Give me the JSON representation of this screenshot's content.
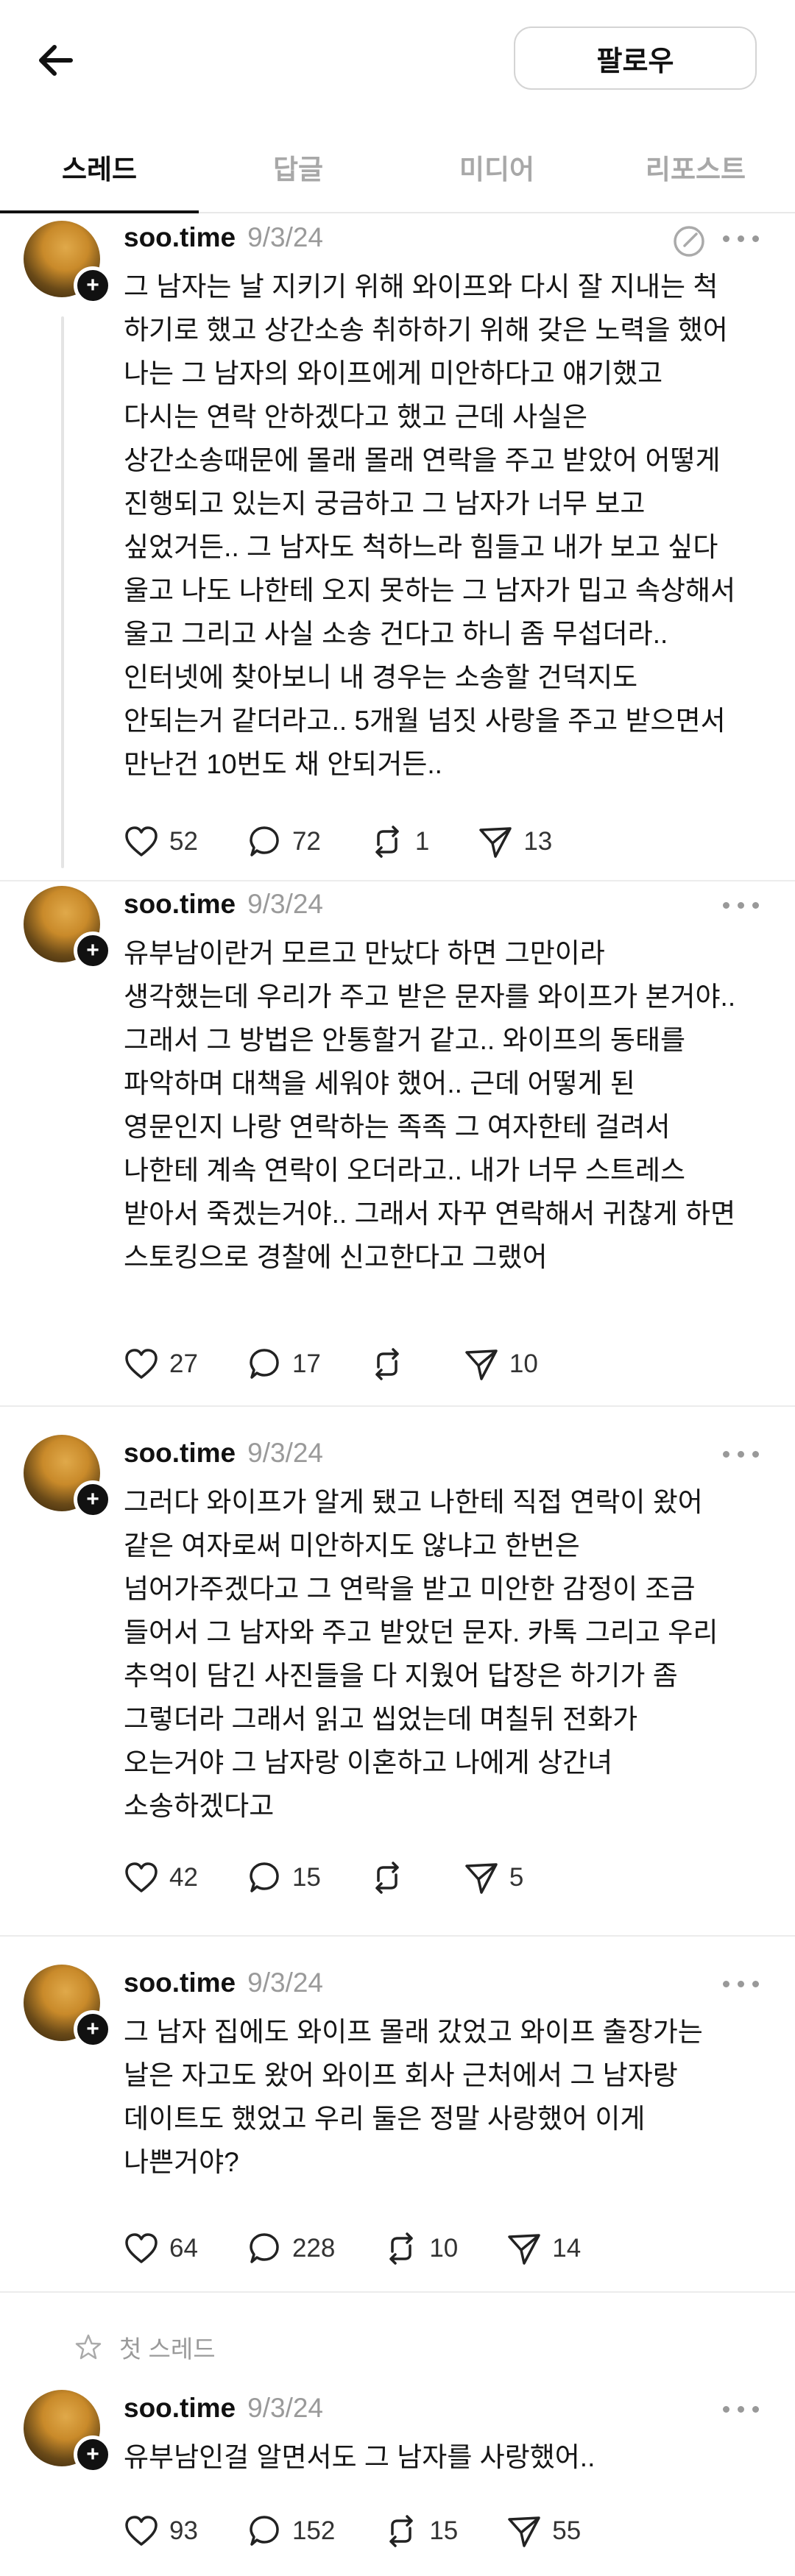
{
  "header": {
    "back_icon": "arrow-left-icon",
    "follow_label": "팔로우"
  },
  "tabs": [
    {
      "label": "스레드",
      "active": true
    },
    {
      "label": "답글",
      "active": false
    },
    {
      "label": "미디어",
      "active": false
    },
    {
      "label": "리포스트",
      "active": false
    }
  ],
  "posts": [
    {
      "username": "soo.time",
      "date": "9/3/24",
      "text": "그 남자는 날 지키기 위해 와이프와 다시 잘 지내는 척\n하기로 했고 상간소송 취하하기 위해 갖은 노력을 했어\n나는 그 남자의 와이프에게 미안하다고 얘기했고\n다시는 연락 안하겠다고 했고 근데 사실은\n상간소송때문에 몰래 몰래 연락을 주고 받았어 어떻게\n진행되고 있는지 궁금하고 그 남자가 너무 보고\n싶었거든.. 그 남자도 척하느라 힘들고 내가 보고 싶다\n울고 나도 나한테 오지 못하는 그 남자가 밉고 속상해서\n울고 그리고 사실 소송 건다고 하니 좀 무섭더라..\n인터넷에 찾아보니 내 경우는 소송할 건덕지도\n안되는거 같더라고.. 5개월 넘짓 사랑을 주고 받으면서\n만난건 10번도 채 안되거든..",
      "likes": "52",
      "replies": "72",
      "reposts": "1",
      "shares": "13"
    },
    {
      "username": "soo.time",
      "date": "9/3/24",
      "text": "유부남이란거 모르고 만났다 하면 그만이라\n생각했는데 우리가 주고 받은 문자를 와이프가 본거야..\n그래서 그 방법은 안통할거 같고.. 와이프의 동태를\n파악하며 대책을 세워야 했어.. 근데 어떻게 된\n영문인지 나랑 연락하는 족족 그 여자한테 걸려서\n나한테 계속 연락이 오더라고.. 내가 너무 스트레스\n받아서 죽겠는거야.. 그래서 자꾸 연락해서 귀찮게 하면\n스토킹으로 경찰에 신고한다고 그랬어",
      "likes": "27",
      "replies": "17",
      "reposts": "",
      "shares": "10"
    },
    {
      "username": "soo.time",
      "date": "9/3/24",
      "text": "그러다 와이프가 알게 됐고 나한테 직접 연락이 왔어\n같은 여자로써 미안하지도 않냐고 한번은\n넘어가주겠다고 그 연락을 받고 미안한 감정이 조금\n들어서 그 남자와 주고 받았던 문자. 카톡 그리고 우리\n추억이 담긴 사진들을 다 지웠어 답장은 하기가 좀\n그렇더라 그래서 읽고 씹었는데 며칠뒤 전화가\n오는거야 그 남자랑 이혼하고 나에게 상간녀\n소송하겠다고",
      "likes": "42",
      "replies": "15",
      "reposts": "",
      "shares": "5"
    },
    {
      "username": "soo.time",
      "date": "9/3/24",
      "text": "그 남자 집에도 와이프 몰래 갔었고 와이프 출장가는\n날은 자고도 왔어 와이프 회사 근처에서 그 남자랑\n데이트도 했었고 우리 둘은 정말 사랑했어 이게\n나쁜거야?",
      "likes": "64",
      "replies": "228",
      "reposts": "10",
      "shares": "14"
    },
    {
      "first_thread_label": "첫 스레드",
      "username": "soo.time",
      "date": "9/3/24",
      "text": "유부남인걸 알면서도 그 남자를 사랑했어..",
      "likes": "93",
      "replies": "152",
      "reposts": "15",
      "shares": "55"
    }
  ]
}
